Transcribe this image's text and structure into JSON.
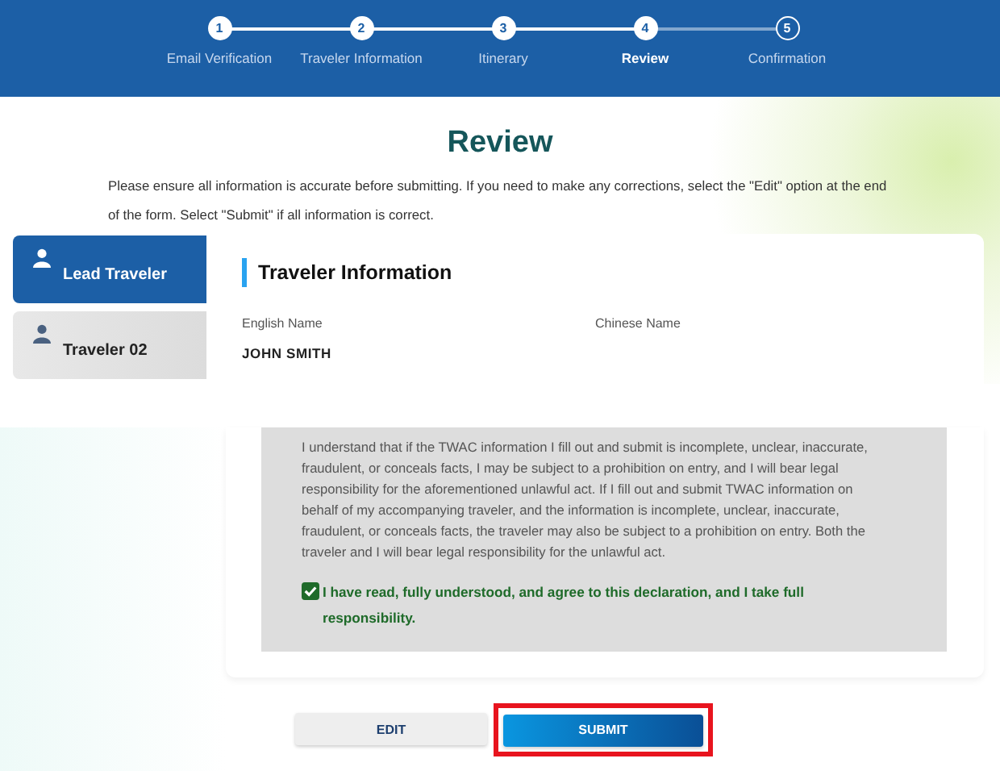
{
  "steps": [
    {
      "number": "1",
      "label": "Email Verification",
      "completed": true,
      "selected": false
    },
    {
      "number": "2",
      "label": "Traveler Information",
      "completed": true,
      "selected": false
    },
    {
      "number": "3",
      "label": "Itinerary",
      "completed": true,
      "selected": false
    },
    {
      "number": "4",
      "label": "Review",
      "completed": true,
      "selected": true
    },
    {
      "number": "5",
      "label": "Confirmation",
      "completed": false,
      "selected": false
    }
  ],
  "title": "Review",
  "intro": "Please ensure all information is accurate before submitting. If you need to make any corrections, select the \"Edit\" option at the end of the form. Select \"Submit\" if all information is correct.",
  "travelers": [
    {
      "label": "Lead Traveler",
      "selected": true
    },
    {
      "label": "Traveler 02",
      "selected": false
    }
  ],
  "section_title": "Traveler Information",
  "fields": [
    {
      "label": "English Name",
      "value": "JOHN SMITH"
    },
    {
      "label": "Chinese Name"
    }
  ],
  "declaration": "I understand that if the TWAC information I fill out and submit is incomplete, unclear, inaccurate, fraudulent, or conceals facts, I may be subject to a prohibition on entry, and I will bear legal responsibility for the aforementioned unlawful act. If I fill out and submit TWAC information on behalf of my accompanying traveler, and the information is incomplete, unclear, inaccurate, fraudulent, or conceals facts, the traveler may also be subject to a prohibition on entry. Both the traveler and I will bear legal responsibility for the unlawful act.",
  "agreement": {
    "checked": true,
    "label": "I have read, fully understood, and agree to this declaration, and I take full responsibility."
  },
  "buttons": [
    {
      "label": "EDIT",
      "kind": "secondary",
      "highlighted": false
    },
    {
      "label": "SUBMIT",
      "kind": "primary",
      "highlighted": true
    }
  ]
}
